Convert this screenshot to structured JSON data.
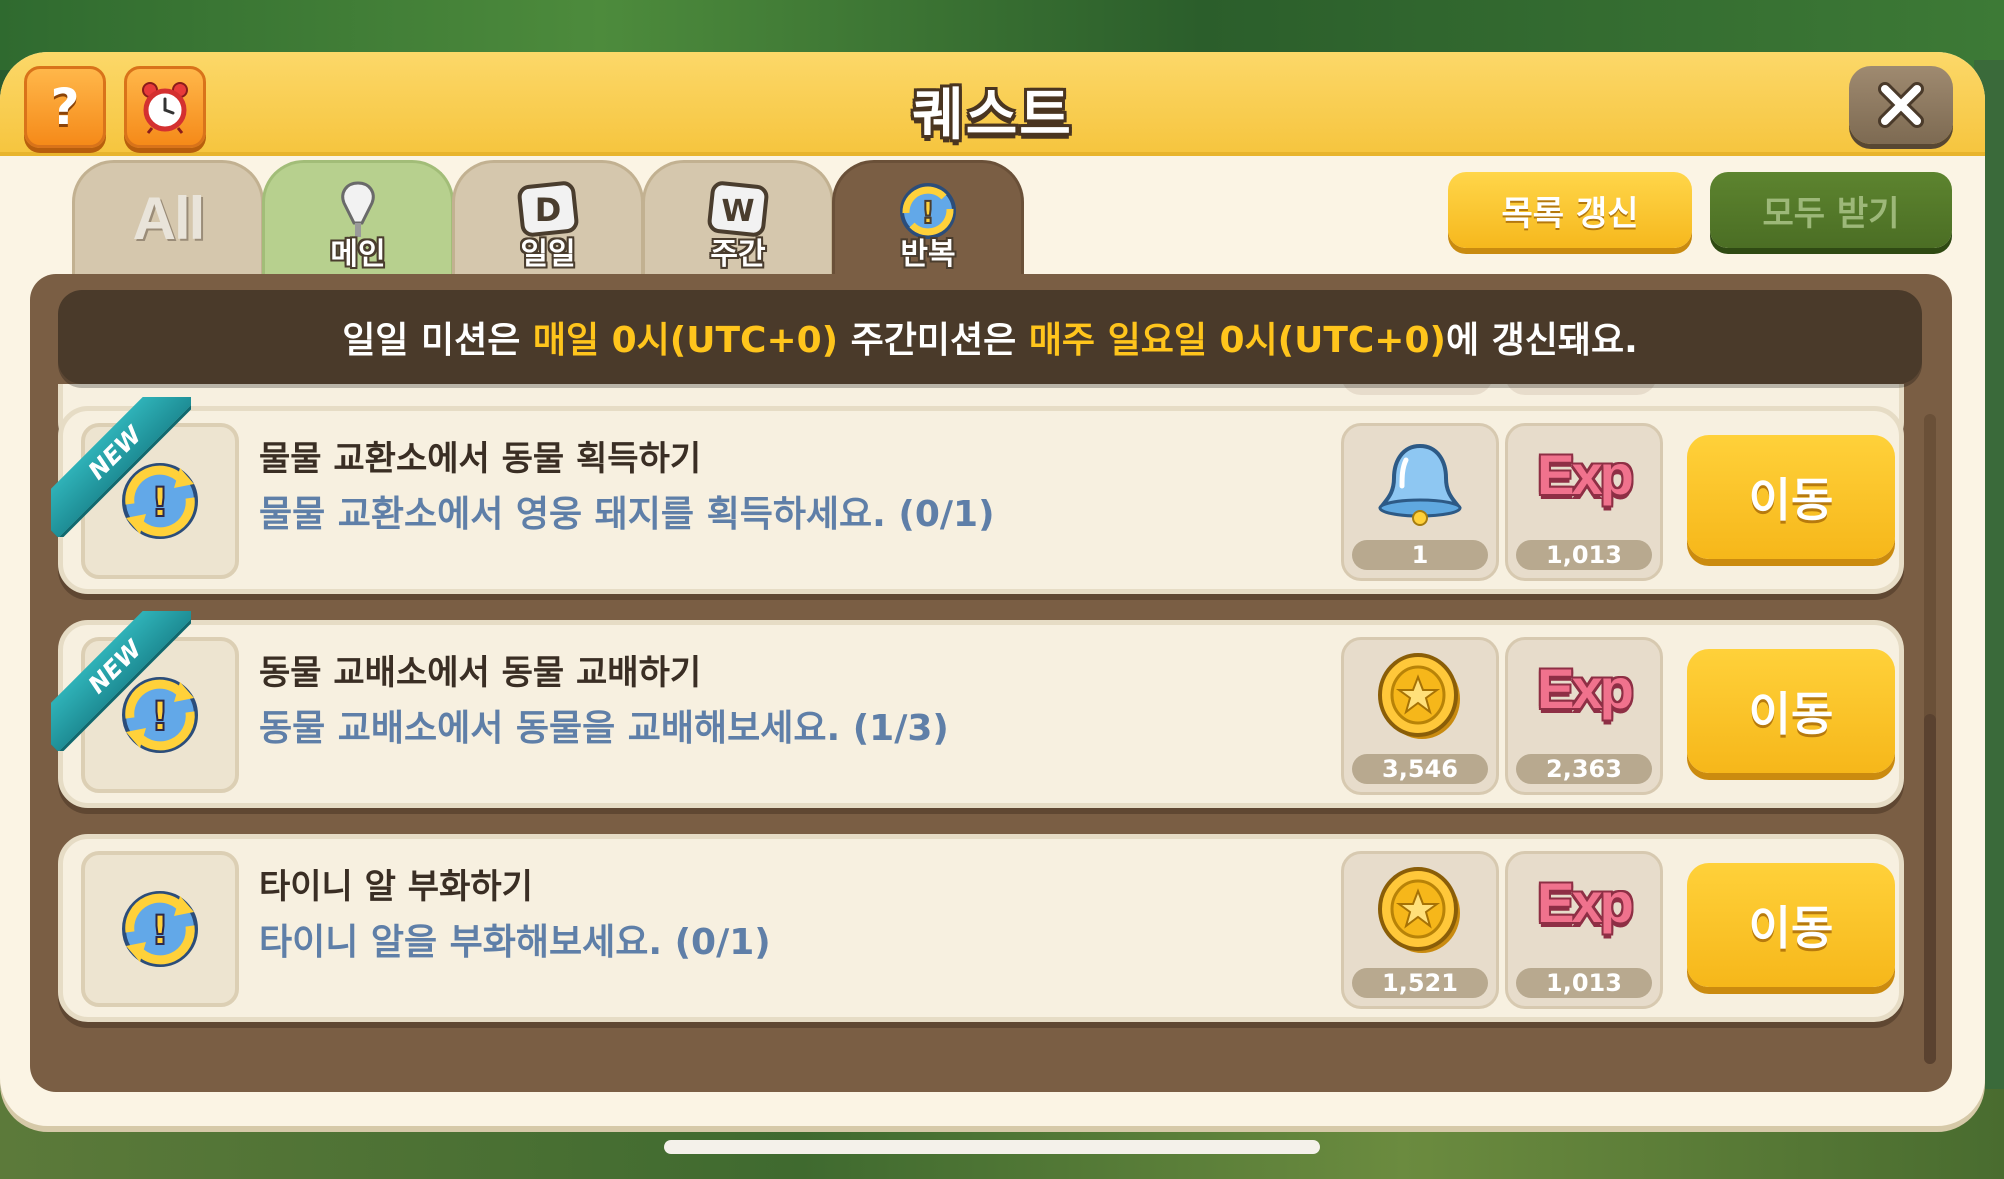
{
  "window": {
    "title": "퀘스트",
    "help_label": "?"
  },
  "tabs": [
    {
      "label": "All",
      "icon": "all-text-icon"
    },
    {
      "label": "메인",
      "icon": "pin-icon"
    },
    {
      "label": "일일",
      "icon": "daily-d-icon"
    },
    {
      "label": "주간",
      "icon": "weekly-w-icon"
    },
    {
      "label": "반복",
      "icon": "repeat-quest-icon",
      "active": true
    }
  ],
  "actions": {
    "refresh_label": "목록 갱신",
    "claim_all_label": "모두 받기"
  },
  "notice": {
    "p1": "일일 미션은 ",
    "h1": "매일 0시(UTC+0)",
    "p2": " 주간미션은 ",
    "h2": "매주 일요일 0시(UTC+0)",
    "p3": "에 갱신돼요."
  },
  "quests": [
    {
      "is_new": true,
      "new_label": "NEW",
      "title": "물물 교환소에서 동물 획득하기",
      "desc": "물물 교환소에서 영웅 돼지를 획득하세요. (0/1)",
      "reward1": {
        "icon": "bell-icon",
        "value": "1"
      },
      "reward2": {
        "icon": "exp-icon",
        "label": "Exp",
        "value": "1,013"
      },
      "go_label": "이동"
    },
    {
      "is_new": true,
      "new_label": "NEW",
      "title": "동물 교배소에서 동물 교배하기",
      "desc": "동물 교배소에서 동물을 교배해보세요. (1/3)",
      "reward1": {
        "icon": "gold-coin-icon",
        "value": "3,546"
      },
      "reward2": {
        "icon": "exp-icon",
        "label": "Exp",
        "value": "2,363"
      },
      "go_label": "이동"
    },
    {
      "is_new": false,
      "title": "타이니 알 부화하기",
      "desc": "타이니 알을 부화해보세요. (0/1)",
      "reward1": {
        "icon": "gold-coin-icon",
        "value": "1,521"
      },
      "reward2": {
        "icon": "exp-icon",
        "label": "Exp",
        "value": "1,013"
      },
      "go_label": "이동"
    }
  ],
  "colors": {
    "header_yellow": "#f6c53f",
    "content_brown": "#7a5e44",
    "highlight_yellow": "#ffc51c",
    "desc_blue": "#5f7fa8",
    "new_ribbon": "#2fb2b8",
    "exp_pink": "#f0728d"
  }
}
